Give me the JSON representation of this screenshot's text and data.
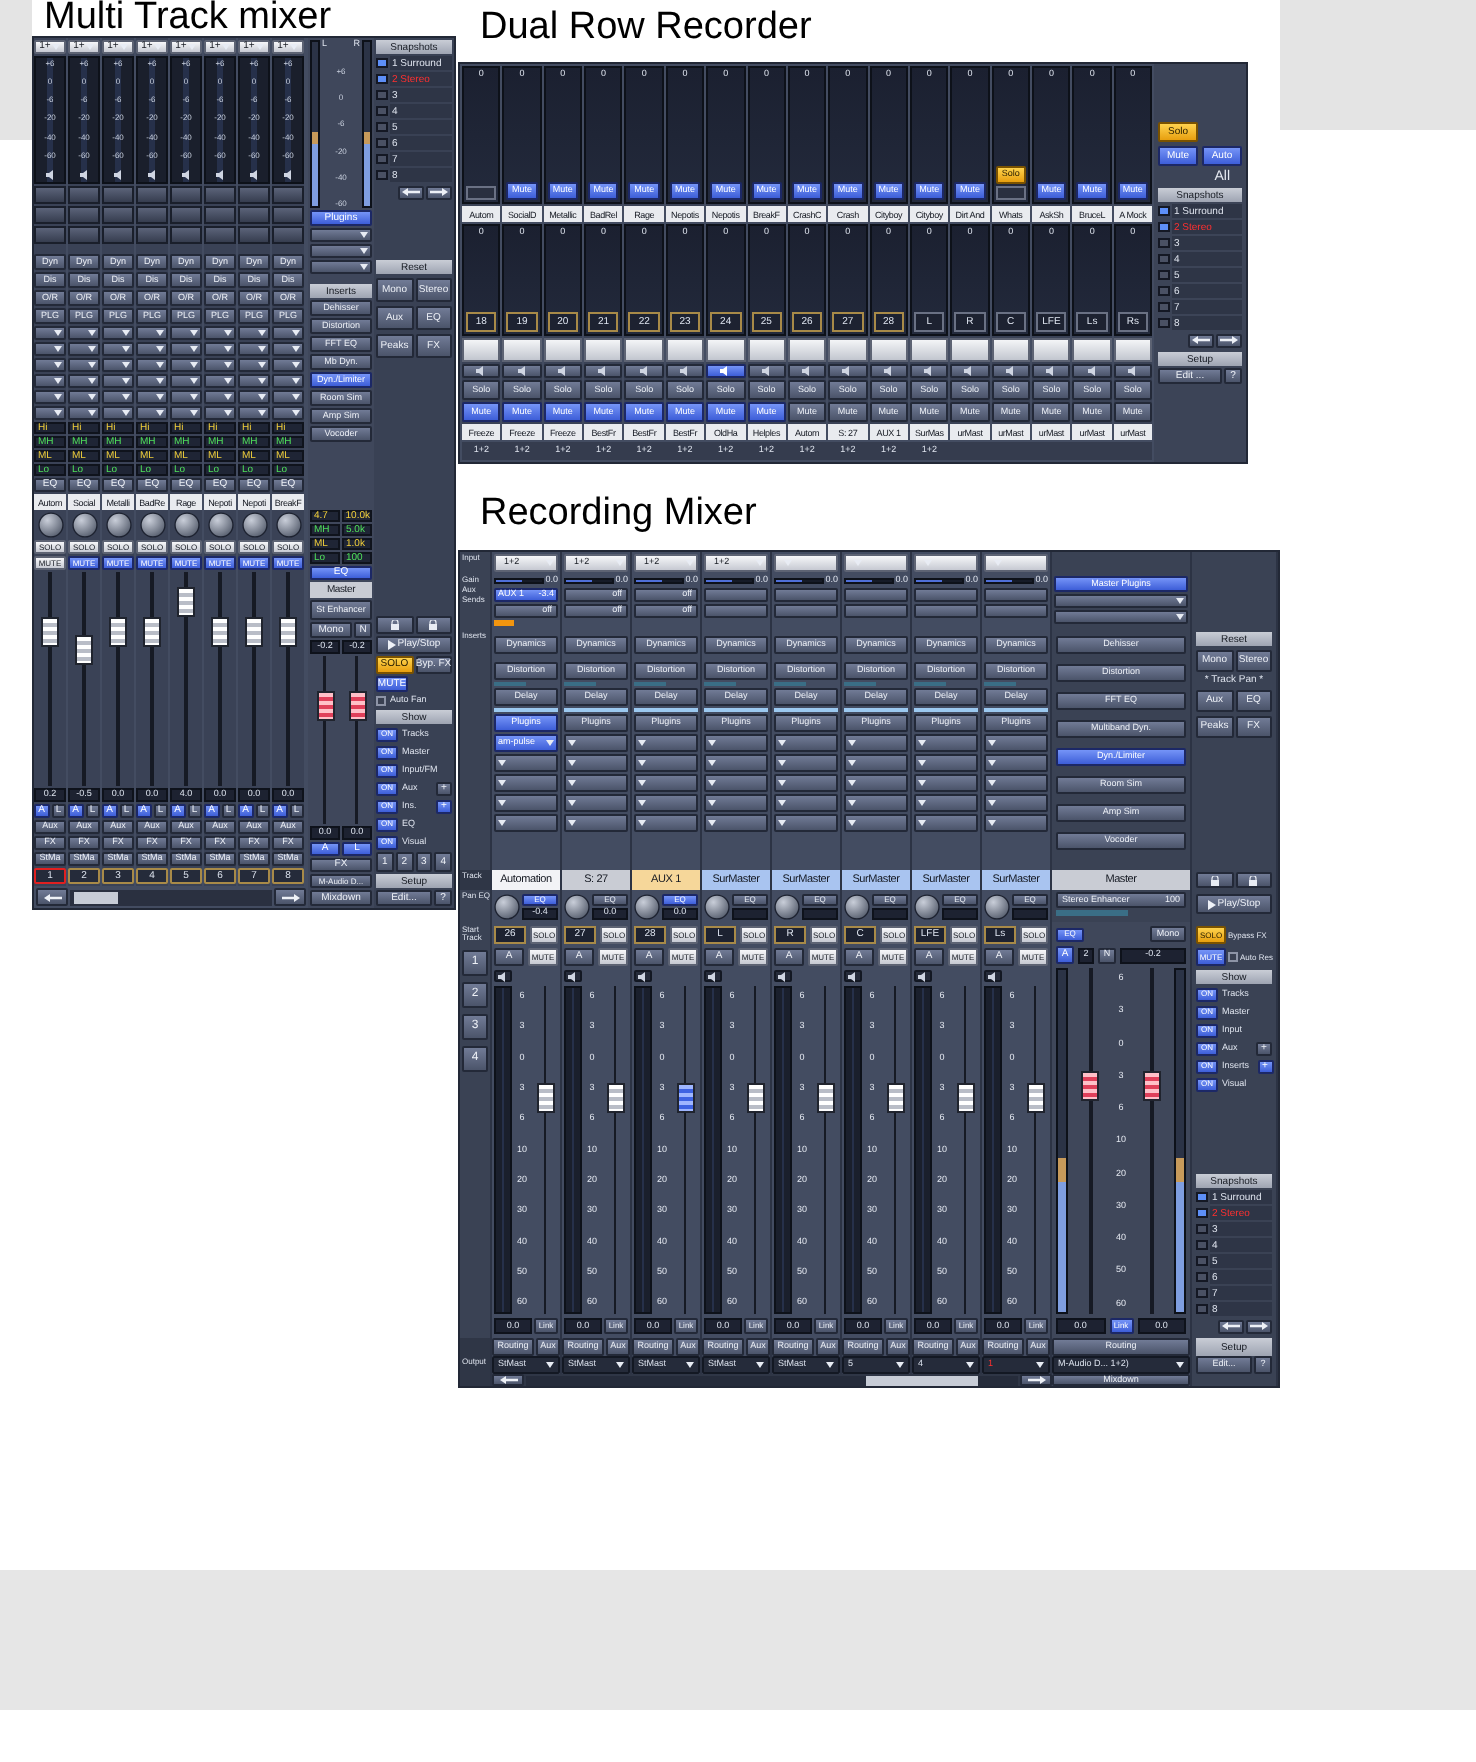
{
  "multi_track_mixer": {
    "title": "Multi Track mixer",
    "channels": [
      {
        "input": "1+",
        "scale": [
          "+6",
          "0",
          "-6",
          "-20",
          "-40",
          "-60"
        ],
        "buttons": [
          "Dyn",
          "Dis",
          "O/R",
          "PLG"
        ],
        "eq": [
          "Hi",
          "MH",
          "ML",
          "Lo"
        ],
        "eq_button": "EQ",
        "name": "Autom",
        "solo": "SOLO",
        "mute": "MUTE",
        "muted": false,
        "level": 0.72,
        "value": "0.2",
        "pan": [
          "A",
          "L"
        ],
        "routes": [
          "Aux",
          "FX",
          "StMa"
        ],
        "number": "1",
        "selected": true
      },
      {
        "input": "1+",
        "scale": [
          "+6",
          "0",
          "-6",
          "-20",
          "-40",
          "-60"
        ],
        "buttons": [
          "Dyn",
          "Dis",
          "O/R",
          "PLG"
        ],
        "eq": [
          "Hi",
          "MH",
          "ML",
          "Lo"
        ],
        "eq_button": "EQ",
        "name": "Social",
        "solo": "SOLO",
        "mute": "MUTE",
        "muted": true,
        "level": 0.64,
        "value": "-0.5",
        "pan": [
          "A",
          "L"
        ],
        "routes": [
          "Aux",
          "FX",
          "StMa"
        ],
        "number": "2",
        "selected": false
      },
      {
        "input": "1+",
        "scale": [
          "+6",
          "0",
          "-6",
          "-20",
          "-40",
          "-60"
        ],
        "buttons": [
          "Dyn",
          "Dis",
          "O/R",
          "PLG"
        ],
        "eq": [
          "Hi",
          "MH",
          "ML",
          "Lo"
        ],
        "eq_button": "EQ",
        "name": "Metalli",
        "solo": "SOLO",
        "mute": "MUTE",
        "muted": true,
        "level": 0.72,
        "value": "0.0",
        "pan": [
          "A",
          "L"
        ],
        "routes": [
          "Aux",
          "FX",
          "StMa"
        ],
        "number": "3",
        "selected": false
      },
      {
        "input": "1+",
        "scale": [
          "+6",
          "0",
          "-6",
          "-20",
          "-40",
          "-60"
        ],
        "buttons": [
          "Dyn",
          "Dis",
          "O/R",
          "PLG"
        ],
        "eq": [
          "Hi",
          "MH",
          "ML",
          "Lo"
        ],
        "eq_button": "EQ",
        "name": "BadRe",
        "solo": "SOLO",
        "mute": "MUTE",
        "muted": true,
        "level": 0.72,
        "value": "0.0",
        "pan": [
          "A",
          "L"
        ],
        "routes": [
          "Aux",
          "FX",
          "StMa"
        ],
        "number": "4",
        "selected": false
      },
      {
        "input": "1+",
        "scale": [
          "+6",
          "0",
          "-6",
          "-20",
          "-40",
          "-60"
        ],
        "buttons": [
          "Dyn",
          "Dis",
          "O/R",
          "PLG"
        ],
        "eq": [
          "Hi",
          "MH",
          "ML",
          "Lo"
        ],
        "eq_button": "EQ",
        "name": "Rage",
        "solo": "SOLO",
        "mute": "MUTE",
        "muted": true,
        "level": 0.86,
        "value": "4.0",
        "pan": [
          "A",
          "L"
        ],
        "routes": [
          "Aux",
          "FX",
          "StMa"
        ],
        "number": "5",
        "selected": false
      },
      {
        "input": "1+",
        "scale": [
          "+6",
          "0",
          "-6",
          "-20",
          "-40",
          "-60"
        ],
        "buttons": [
          "Dyn",
          "Dis",
          "O/R",
          "PLG"
        ],
        "eq": [
          "Hi",
          "MH",
          "ML",
          "Lo"
        ],
        "eq_button": "EQ",
        "name": "Nepoti",
        "solo": "SOLO",
        "mute": "MUTE",
        "muted": true,
        "level": 0.72,
        "value": "0.0",
        "pan": [
          "A",
          "L"
        ],
        "routes": [
          "Aux",
          "FX",
          "StMa"
        ],
        "number": "6",
        "selected": false
      },
      {
        "input": "1+",
        "scale": [
          "+6",
          "0",
          "-6",
          "-20",
          "-40",
          "-60"
        ],
        "buttons": [
          "Dyn",
          "Dis",
          "O/R",
          "PLG"
        ],
        "eq": [
          "Hi",
          "MH",
          "ML",
          "Lo"
        ],
        "eq_button": "EQ",
        "name": "Nepoti",
        "solo": "SOLO",
        "mute": "MUTE",
        "muted": true,
        "level": 0.72,
        "value": "0.0",
        "pan": [
          "A",
          "L"
        ],
        "routes": [
          "Aux",
          "FX",
          "StMa"
        ],
        "number": "7",
        "selected": false
      },
      {
        "input": "1+",
        "scale": [
          "+6",
          "0",
          "-6",
          "-20",
          "-40",
          "-60"
        ],
        "buttons": [
          "Dyn",
          "Dis",
          "O/R",
          "PLG"
        ],
        "eq": [
          "Hi",
          "MH",
          "ML",
          "Lo"
        ],
        "eq_button": "EQ",
        "name": "BreakF",
        "solo": "SOLO",
        "mute": "MUTE",
        "muted": true,
        "level": 0.72,
        "value": "0.0",
        "pan": [
          "A",
          "L"
        ],
        "routes": [
          "Aux",
          "FX",
          "StMa"
        ],
        "number": "8",
        "selected": false
      }
    ],
    "master": {
      "labels": [
        "L",
        "R"
      ],
      "scale": [
        "+6",
        "0",
        "-6",
        "-20",
        "-40",
        "-60"
      ],
      "plugins": "Plugins",
      "inserts_title": "Inserts",
      "inserts": [
        {
          "label": "Dehisser",
          "on": false
        },
        {
          "label": "Distortion",
          "on": false
        },
        {
          "label": "FFT EQ",
          "on": false
        },
        {
          "label": "Mb Dyn.",
          "on": false
        },
        {
          "label": "Dyn./Limiter",
          "on": true
        },
        {
          "label": "Room Sim",
          "on": false
        },
        {
          "label": "Amp Sim",
          "on": false
        },
        {
          "label": "Vocoder",
          "on": false
        }
      ],
      "eq": [
        "4.7",
        "10.0k",
        "MH",
        "5.0k",
        "ML",
        "1.0k",
        "Lo",
        "100"
      ],
      "eq_button": "EQ",
      "name": "Master",
      "enhancer": "St Enhancer",
      "mono": "Mono",
      "n": "N",
      "trims": [
        "-0.2",
        "-0.2"
      ],
      "faders": [
        {
          "level": 0.7
        },
        {
          "level": 0.7
        }
      ],
      "values": [
        "0.0",
        "0.0"
      ],
      "pan": [
        "A",
        "L"
      ],
      "fx": "FX",
      "output": "M-Audio D...",
      "mixdown": "Mixdown"
    },
    "side": {
      "snapshots": {
        "title": "Snapshots",
        "items": [
          {
            "label": "1 Surround",
            "selected": true,
            "current": false
          },
          {
            "label": "2 Stereo",
            "selected": true,
            "current": true
          },
          {
            "label": "3",
            "selected": false,
            "current": false
          },
          {
            "label": "4",
            "selected": false,
            "current": false
          },
          {
            "label": "5",
            "selected": false,
            "current": false
          },
          {
            "label": "6",
            "selected": false,
            "current": false
          },
          {
            "label": "7",
            "selected": false,
            "current": false
          },
          {
            "label": "8",
            "selected": false,
            "current": false
          }
        ]
      },
      "reset": {
        "title": "Reset",
        "buttons": [
          "Mono",
          "Stereo",
          "Aux",
          "EQ",
          "Peaks",
          "FX"
        ]
      },
      "play": "Play/Stop",
      "solo": "SOLO",
      "bypass": "Byp. FX",
      "mute": "MUTE",
      "auto": {
        "label": "Auto Fan",
        "checked": false
      },
      "show": {
        "title": "Show",
        "items": [
          {
            "toggle": "ON",
            "label": "Tracks",
            "on": true
          },
          {
            "toggle": "ON",
            "label": "Master",
            "on": true
          },
          {
            "toggle": "ON",
            "label": "Input/FM",
            "on": true
          },
          {
            "toggle": "ON",
            "label": "Aux",
            "on": true,
            "add": "+",
            "add_on": false
          },
          {
            "toggle": "ON",
            "label": "Ins.",
            "on": true,
            "add": "+",
            "add_on": true
          },
          {
            "toggle": "ON",
            "label": "EQ",
            "on": true
          },
          {
            "toggle": "ON",
            "label": "Visual",
            "on": true
          }
        ]
      },
      "pages": [
        {
          "label": "1",
          "selected": false
        },
        {
          "label": "2",
          "selected": false
        },
        {
          "label": "3",
          "selected": false
        },
        {
          "label": "4",
          "selected": false
        }
      ],
      "setup": {
        "title": "Setup",
        "buttons": [
          "Edit...",
          "?"
        ]
      }
    }
  },
  "dual_row_recorder": {
    "title": "Dual Row Recorder",
    "top": [
      {
        "peak": "0",
        "name": "Autom"
      },
      {
        "peak": "0",
        "name": "SocialD",
        "mute": "Mute",
        "muted": true
      },
      {
        "peak": "0",
        "name": "Metallic",
        "mute": "Mute",
        "muted": true
      },
      {
        "peak": "0",
        "name": "BadRel",
        "mute": "Mute",
        "muted": true
      },
      {
        "peak": "0",
        "name": "Rage",
        "mute": "Mute",
        "muted": true
      },
      {
        "peak": "0",
        "name": "Nepotis",
        "mute": "Mute",
        "muted": true
      },
      {
        "peak": "0",
        "name": "Nepotis",
        "mute": "Mute",
        "muted": true
      },
      {
        "peak": "0",
        "name": "BreakF",
        "mute": "Mute",
        "muted": true
      },
      {
        "peak": "0",
        "name": "CrashC",
        "mute": "Mute",
        "muted": true
      },
      {
        "peak": "0",
        "name": "Crash",
        "mute": "Mute",
        "muted": true
      },
      {
        "peak": "0",
        "name": "Cityboy",
        "mute": "Mute",
        "muted": true
      },
      {
        "peak": "0",
        "name": "Cityboy",
        "mute": "Mute",
        "muted": true
      },
      {
        "peak": "0",
        "name": "Dirt And",
        "mute": "Mute",
        "muted": true
      },
      {
        "peak": "0",
        "name": "Whats",
        "solo": "Solo",
        "soloed": true
      },
      {
        "peak": "0",
        "name": "AskSh",
        "mute": "Mute",
        "muted": true
      },
      {
        "peak": "0",
        "name": "BruceL",
        "mute": "Mute",
        "muted": true
      },
      {
        "peak": "0",
        "name": "A Mock",
        "mute": "Mute",
        "muted": true
      }
    ],
    "bottom": [
      {
        "peak": "0",
        "number": "18",
        "solo": "Solo",
        "mute": "Mute",
        "muted": true,
        "monitor": false,
        "name": "Freeze",
        "routing": "1+2"
      },
      {
        "peak": "0",
        "number": "19",
        "solo": "Solo",
        "mute": "Mute",
        "muted": true,
        "monitor": false,
        "name": "Freeze",
        "routing": "1+2"
      },
      {
        "peak": "0",
        "number": "20",
        "solo": "Solo",
        "mute": "Mute",
        "muted": true,
        "monitor": false,
        "name": "Freeze",
        "routing": "1+2"
      },
      {
        "peak": "0",
        "number": "21",
        "solo": "Solo",
        "mute": "Mute",
        "muted": true,
        "monitor": false,
        "name": "BestFr",
        "routing": "1+2"
      },
      {
        "peak": "0",
        "number": "22",
        "solo": "Solo",
        "mute": "Mute",
        "muted": true,
        "monitor": false,
        "name": "BestFr",
        "routing": "1+2"
      },
      {
        "peak": "0",
        "number": "23",
        "solo": "Solo",
        "mute": "Mute",
        "muted": true,
        "monitor": false,
        "name": "BestFr",
        "routing": "1+2"
      },
      {
        "peak": "0",
        "number": "24",
        "solo": "Solo",
        "mute": "Mute",
        "muted": true,
        "monitor": true,
        "name": "OldHa",
        "routing": "1+2"
      },
      {
        "peak": "0",
        "number": "25",
        "solo": "Solo",
        "mute": "Mute",
        "muted": true,
        "monitor": false,
        "name": "Helples",
        "routing": "1+2"
      },
      {
        "peak": "0",
        "number": "26",
        "solo": "Solo",
        "mute": "Mute",
        "muted": false,
        "monitor": false,
        "name": "Autom",
        "routing": "1+2"
      },
      {
        "peak": "0",
        "number": "27",
        "solo": "Solo",
        "mute": "Mute",
        "muted": false,
        "monitor": false,
        "name": "S: 27",
        "routing": "1+2"
      },
      {
        "peak": "0",
        "number": "28",
        "solo": "Solo",
        "mute": "Mute",
        "muted": false,
        "monitor": false,
        "name": "AUX 1",
        "routing": "1+2"
      },
      {
        "peak": "0",
        "number": "L",
        "solo": "Solo",
        "mute": "Mute",
        "muted": false,
        "monitor": false,
        "name": "SurMas",
        "routing": "1+2"
      },
      {
        "peak": "0",
        "number": "R",
        "solo": "Solo",
        "mute": "Mute",
        "muted": false,
        "monitor": false,
        "name": "urMast"
      },
      {
        "peak": "0",
        "number": "C",
        "solo": "Solo",
        "mute": "Mute",
        "muted": false,
        "monitor": false,
        "name": "urMast"
      },
      {
        "peak": "0",
        "number": "LFE",
        "solo": "Solo",
        "mute": "Mute",
        "muted": false,
        "monitor": false,
        "name": "urMast"
      },
      {
        "peak": "0",
        "number": "Ls",
        "solo": "Solo",
        "mute": "Mute",
        "muted": false,
        "monitor": false,
        "name": "urMast"
      },
      {
        "peak": "0",
        "number": "Rs",
        "solo": "Solo",
        "mute": "Mute",
        "muted": false,
        "monitor": false,
        "name": "urMast"
      }
    ],
    "side": {
      "solo": "Solo",
      "mute": "Mute",
      "auto": "Auto",
      "all": "All",
      "snapshots": {
        "title": "Snapshots",
        "items": [
          {
            "label": "1 Surround",
            "selected": true,
            "current": false
          },
          {
            "label": "2 Stereo",
            "selected": true,
            "current": true
          },
          {
            "label": "3",
            "selected": false,
            "current": false
          },
          {
            "label": "4",
            "selected": false,
            "current": false
          },
          {
            "label": "5",
            "selected": false,
            "current": false
          },
          {
            "label": "6",
            "selected": false,
            "current": false
          },
          {
            "label": "7",
            "selected": false,
            "current": false
          },
          {
            "label": "8",
            "selected": false,
            "current": false
          }
        ]
      },
      "setup": {
        "title": "Setup",
        "buttons": [
          "Edit ...",
          "?"
        ]
      }
    }
  },
  "recording_mixer": {
    "title": "Recording Mixer",
    "labels": {
      "input": "Input",
      "gain": "Gain",
      "sends": "Aux Sends",
      "inserts": "Inserts",
      "track": "Track",
      "pan": "Pan EQ",
      "start": "Start Track",
      "output": "Output"
    },
    "pages": [
      {
        "label": "1",
        "selected": false
      },
      {
        "label": "2",
        "selected": false
      },
      {
        "label": "3",
        "selected": false
      },
      {
        "label": "4",
        "selected": false
      }
    ],
    "channels": [
      {
        "input": "1+2",
        "gain": {
          "value": "0.0",
          "level": 0.55
        },
        "sends": [
          {
            "label": "AUX 1",
            "value": "-3.4",
            "on": true
          },
          {
            "value": "off"
          }
        ],
        "inserts": [
          "Dynamics",
          "Distortion",
          "Delay"
        ],
        "plugins": "Plugins",
        "plugins_on": true,
        "slot": "am-pulse",
        "track": "Automation",
        "color": "#f2f3f6",
        "eq": "EQ",
        "eq_on": true,
        "pan_value": "-0.4",
        "number": "26",
        "solo": "SOLO",
        "mute": "MUTE",
        "auto": "A",
        "scale": [
          "6",
          "3",
          "0",
          "3",
          "6",
          "10",
          "20",
          "30",
          "40",
          "50",
          "60"
        ],
        "selected": false,
        "level": 0.66,
        "value": "0.0",
        "link": "Link",
        "routing": "Routing",
        "aux": "Aux",
        "output": "StMast",
        "output_warning": false
      },
      {
        "input": "1+2",
        "gain": {
          "value": "0.0",
          "level": 0.55
        },
        "sends": [
          {
            "value": "off"
          },
          {
            "value": "off"
          }
        ],
        "inserts": [
          "Dynamics",
          "Distortion",
          "Delay"
        ],
        "plugins": "Plugins",
        "plugins_on": false,
        "track": "S: 27",
        "color": "#c9ccd4",
        "eq": "EQ",
        "eq_on": false,
        "pan_value": "0.0",
        "number": "27",
        "solo": "SOLO",
        "mute": "MUTE",
        "auto": "A",
        "scale": [
          "6",
          "3",
          "0",
          "3",
          "6",
          "10",
          "20",
          "30",
          "40",
          "50",
          "60"
        ],
        "selected": false,
        "level": 0.66,
        "value": "0.0",
        "link": "Link",
        "routing": "Routing",
        "aux": "Aux",
        "output": "StMast",
        "output_warning": false
      },
      {
        "input": "1+2",
        "gain": {
          "value": "0.0",
          "level": 0.55
        },
        "sends": [
          {
            "value": "off"
          },
          {
            "value": "off"
          }
        ],
        "inserts": [
          "Dynamics",
          "Distortion",
          "Delay"
        ],
        "plugins": "Plugins",
        "plugins_on": false,
        "track": "AUX 1",
        "color": "#f6d79a",
        "eq": "EQ",
        "eq_on": true,
        "pan_value": "0.0",
        "number": "28",
        "solo": "SOLO",
        "mute": "MUTE",
        "auto": "A",
        "scale": [
          "6",
          "3",
          "0",
          "3",
          "6",
          "10",
          "20",
          "30",
          "40",
          "50",
          "60"
        ],
        "selected": true,
        "level": 0.66,
        "value": "0.0",
        "link": "Link",
        "routing": "Routing",
        "aux": "Aux",
        "output": "StMast",
        "output_warning": false
      },
      {
        "input": "1+2",
        "gain": {
          "value": "0.0",
          "level": 0.55
        },
        "inserts": [
          "Dynamics",
          "Distortion",
          "Delay"
        ],
        "plugins": "Plugins",
        "plugins_on": false,
        "track": "SurMaster",
        "color": "#a9c4f0",
        "eq": "EQ",
        "eq_on": false,
        "number": "L",
        "solo": "SOLO",
        "mute": "MUTE",
        "auto": "A",
        "scale": [
          "6",
          "3",
          "0",
          "3",
          "6",
          "10",
          "20",
          "30",
          "40",
          "50",
          "60"
        ],
        "selected": false,
        "level": 0.66,
        "value": "0.0",
        "link": "Link",
        "routing": "Routing",
        "aux": "Aux",
        "output": "StMast",
        "output_warning": false
      },
      {
        "gain": {
          "value": "0.0",
          "level": 0.55
        },
        "inserts": [
          "Dynamics",
          "Distortion",
          "Delay"
        ],
        "plugins": "Plugins",
        "plugins_on": false,
        "track": "SurMaster",
        "color": "#a9c4f0",
        "eq": "EQ",
        "eq_on": false,
        "number": "R",
        "solo": "SOLO",
        "mute": "MUTE",
        "auto": "A",
        "scale": [
          "6",
          "3",
          "0",
          "3",
          "6",
          "10",
          "20",
          "30",
          "40",
          "50",
          "60"
        ],
        "selected": false,
        "level": 0.66,
        "value": "0.0",
        "link": "Link",
        "routing": "Routing",
        "aux": "Aux",
        "output": "StMast",
        "output_warning": false
      },
      {
        "gain": {
          "value": "0.0",
          "level": 0.55
        },
        "inserts": [
          "Dynamics",
          "Distortion",
          "Delay"
        ],
        "plugins": "Plugins",
        "plugins_on": false,
        "track": "SurMaster",
        "color": "#a9c4f0",
        "eq": "EQ",
        "eq_on": false,
        "number": "C",
        "solo": "SOLO",
        "mute": "MUTE",
        "auto": "A",
        "scale": [
          "6",
          "3",
          "0",
          "3",
          "6",
          "10",
          "20",
          "30",
          "40",
          "50",
          "60"
        ],
        "selected": false,
        "level": 0.66,
        "value": "0.0",
        "link": "Link",
        "routing": "Routing",
        "aux": "Aux",
        "output": "5",
        "output_warning": false
      },
      {
        "gain": {
          "value": "0.0",
          "level": 0.55
        },
        "inserts": [
          "Dynamics",
          "Distortion",
          "Delay"
        ],
        "plugins": "Plugins",
        "plugins_on": false,
        "track": "SurMaster",
        "color": "#a9c4f0",
        "eq": "EQ",
        "eq_on": false,
        "number": "LFE",
        "solo": "SOLO",
        "mute": "MUTE",
        "auto": "A",
        "scale": [
          "6",
          "3",
          "0",
          "3",
          "6",
          "10",
          "20",
          "30",
          "40",
          "50",
          "60"
        ],
        "selected": false,
        "level": 0.66,
        "value": "0.0",
        "link": "Link",
        "routing": "Routing",
        "aux": "Aux",
        "output": "4",
        "output_warning": false
      },
      {
        "gain": {
          "value": "0.0",
          "level": 0.55
        },
        "inserts": [
          "Dynamics",
          "Distortion",
          "Delay"
        ],
        "plugins": "Plugins",
        "plugins_on": false,
        "track": "SurMaster",
        "color": "#a9c4f0",
        "eq": "EQ",
        "eq_on": false,
        "number": "Ls",
        "solo": "SOLO",
        "mute": "MUTE",
        "auto": "A",
        "scale": [
          "6",
          "3",
          "0",
          "3",
          "6",
          "10",
          "20",
          "30",
          "40",
          "50",
          "60"
        ],
        "selected": false,
        "level": 0.66,
        "value": "0.0",
        "link": "Link",
        "routing": "Routing",
        "aux": "Aux",
        "output": "1",
        "output_warning": true
      }
    ],
    "master": {
      "plugins": "Master Plugins",
      "inserts": [
        {
          "label": "Dehisser",
          "on": false
        },
        {
          "label": "Distortion",
          "on": false
        },
        {
          "label": "FFT EQ",
          "on": false
        },
        {
          "label": "Multiband Dyn.",
          "on": false
        },
        {
          "label": "Dyn./Limiter",
          "on": true
        },
        {
          "label": "Room Sim",
          "on": false
        },
        {
          "label": "Amp Sim",
          "on": false
        },
        {
          "label": "Vocoder",
          "on": false
        }
      ],
      "name": "Master",
      "enhancer": "Stereo Enhancer",
      "enhancer_value": "100",
      "eq": "EQ",
      "mono": "Mono",
      "auto": "A",
      "channel": "2",
      "n": "N",
      "trim": "-0.2",
      "scale": [
        "6",
        "3",
        "0",
        "3",
        "6",
        "10",
        "20",
        "30",
        "40",
        "50",
        "60"
      ],
      "faders": [
        {
          "level": 0.66
        },
        {
          "level": 0.66
        }
      ],
      "values": [
        "0.0",
        "0.0"
      ],
      "link": "Link",
      "link_on": true,
      "routing": "Routing",
      "output": "M-Audio D... 1+2)",
      "mixdown": "Mixdown"
    },
    "side": {
      "reset": {
        "title": "Reset",
        "buttons": [
          "Mono",
          "Stereo",
          "Aux",
          "EQ",
          "Peaks",
          "FX"
        ],
        "note": "* Track Pan *"
      },
      "play": "Play/Stop",
      "solo": "SOLO",
      "bypass": "Bypass FX",
      "mute": "MUTE",
      "auto": {
        "label": "Auto Res",
        "checked": false
      },
      "show": {
        "title": "Show",
        "items": [
          {
            "toggle": "ON",
            "label": "Tracks",
            "on": true
          },
          {
            "toggle": "ON",
            "label": "Master",
            "on": true
          },
          {
            "toggle": "ON",
            "label": "Input",
            "on": true
          },
          {
            "toggle": "ON",
            "label": "Aux",
            "on": true,
            "add": "+",
            "add_on": false
          },
          {
            "toggle": "ON",
            "label": "Inserts",
            "on": true,
            "add": "+",
            "add_on": true
          },
          {
            "toggle": "ON",
            "label": "Visual",
            "on": true
          }
        ]
      },
      "snapshots": {
        "title": "Snapshots",
        "items": [
          {
            "label": "1 Surround",
            "selected": true,
            "current": false
          },
          {
            "label": "2 Stereo",
            "selected": true,
            "current": true
          },
          {
            "label": "3",
            "selected": false,
            "current": false
          },
          {
            "label": "4",
            "selected": false,
            "current": false
          },
          {
            "label": "5",
            "selected": false,
            "current": false
          },
          {
            "label": "6",
            "selected": false,
            "current": false
          },
          {
            "label": "7",
            "selected": false,
            "current": false
          },
          {
            "label": "8",
            "selected": false,
            "current": false
          }
        ]
      },
      "setup": {
        "title": "Setup",
        "buttons": [
          "Edit...",
          "?"
        ]
      }
    }
  }
}
